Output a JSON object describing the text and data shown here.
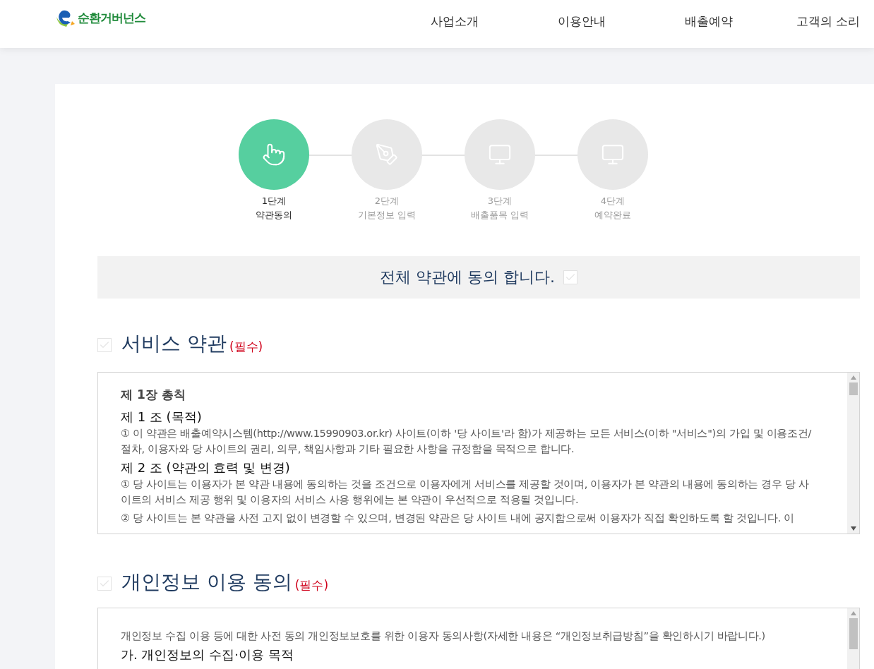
{
  "header": {
    "logo_text": "순환거버넌스",
    "nav": [
      "사업소개",
      "이용안내",
      "배출예약",
      "고객의 소리"
    ]
  },
  "steps": [
    {
      "number": "1단계",
      "label": "약관동의",
      "selected": true
    },
    {
      "number": "2단계",
      "label": "기본정보 입력",
      "selected": false
    },
    {
      "number": "3단계",
      "label": "배출품목 입력",
      "selected": false
    },
    {
      "number": "4단계",
      "label": "예약완료",
      "selected": false
    }
  ],
  "agree_all": {
    "label": "전체 약관에 동의 합니다.",
    "checked": false
  },
  "sections": [
    {
      "title": "서비스 약관",
      "required": "(필수)",
      "checked": false,
      "content": [
        {
          "kind": "chapter",
          "text": "제 1장 총칙"
        },
        {
          "kind": "article",
          "text": "제 1 조 (목적)"
        },
        {
          "kind": "paragraph",
          "text": "① 이 약관은 배출예약시스템(http://www.15990903.or.kr) 사이트(이하 '당 사이트'라 함)가 제공하는 모든 서비스(이하 \"서비스\")의 가입 및 이용조건/절차, 이용자와 당 사이트의 권리, 의무, 책임사항과 기타 필요한 사항을 규정함을 목적으로 합니다."
        },
        {
          "kind": "article",
          "text": "제 2 조 (약관의 효력 및 변경)"
        },
        {
          "kind": "paragraph",
          "text": "① 당 사이트는 이용자가 본 약관 내용에 동의하는 것을 조건으로 이용자에게 서비스를 제공할 것이며, 이용자가 본 약관의 내용에 동의하는 경우 당 사이트의 서비스 제공 행위 및 이용자의 서비스 사용 행위에는 본 약관이 우선적으로 적용될 것입니다."
        },
        {
          "kind": "paragraph",
          "text": "② 당 사이트는 본 약관을 사전 고지 없이 변경할 수 있으며, 변경된 약관은 당 사이트 내에 공지함으로써 이용자가 직접 확인하도록 할 것입니다. 이"
        }
      ]
    },
    {
      "title": "개인정보 이용 동의",
      "required": "(필수)",
      "checked": false,
      "content": [
        {
          "kind": "paragraph",
          "text": "개인정보 수집 이용 등에 대한 사전 동의 개인정보보호를 위한 이용자 동의사항(자세한 내용은 “개인정보취급방침”을 확인하시기 바랍니다.)"
        },
        {
          "kind": "article",
          "text": "가. 개인정보의 수집·이용 목적"
        }
      ]
    }
  ]
}
